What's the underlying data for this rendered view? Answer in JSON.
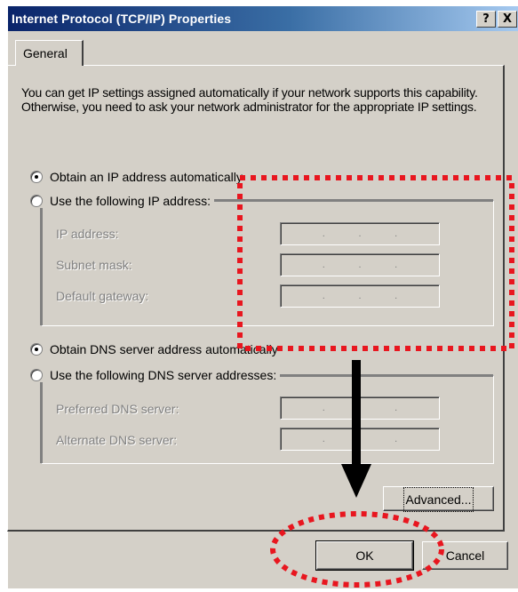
{
  "window": {
    "title": "Internet Protocol (TCP/IP) Properties",
    "help_button": "?",
    "close_button": "X"
  },
  "tabs": [
    {
      "label": "General",
      "selected": true
    }
  ],
  "description": "You can get IP settings assigned automatically if your network supports this capability. Otherwise, you need to ask your network administrator for the appropriate IP settings.",
  "ip": {
    "auto_label": "Obtain an IP address automatically",
    "auto_checked": true,
    "manual_label": "Use the following IP address:",
    "manual_checked": false,
    "fields": [
      {
        "label": "IP address:",
        "value": ". . ."
      },
      {
        "label": "Subnet mask:",
        "value": ". . ."
      },
      {
        "label": "Default gateway:",
        "value": ". . ."
      }
    ]
  },
  "dns": {
    "auto_label": "Obtain DNS server address automatically",
    "auto_checked": true,
    "manual_label": "Use the following DNS server addresses:",
    "manual_checked": false,
    "fields": [
      {
        "label": "Preferred DNS server:",
        "value": ". . ."
      },
      {
        "label": "Alternate DNS server:",
        "value": ". . ."
      }
    ]
  },
  "buttons": {
    "advanced": "Advanced...",
    "ok": "OK",
    "cancel": "Cancel"
  },
  "annotation_color": "#e8161f"
}
